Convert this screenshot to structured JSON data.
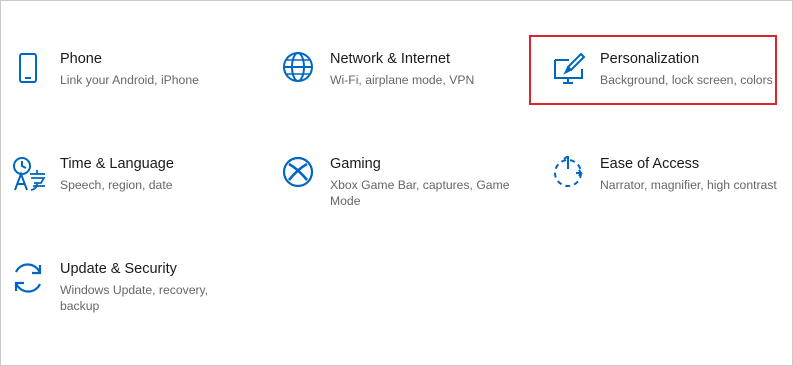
{
  "settings": {
    "items": [
      {
        "title": "Phone",
        "description": "Link your Android, iPhone",
        "icon": "phone-icon"
      },
      {
        "title": "Network & Internet",
        "description": "Wi-Fi, airplane mode, VPN",
        "icon": "globe-icon"
      },
      {
        "title": "Personalization",
        "description": "Background, lock screen, colors",
        "icon": "personalization-icon"
      },
      {
        "title": "Time & Language",
        "description": "Speech, region, date",
        "icon": "time-language-icon"
      },
      {
        "title": "Gaming",
        "description": "Xbox Game Bar, captures, Game Mode",
        "icon": "xbox-icon"
      },
      {
        "title": "Ease of Access",
        "description": "Narrator, magnifier, high contrast",
        "icon": "ease-of-access-icon"
      },
      {
        "title": "Update & Security",
        "description": "Windows Update, recovery, backup",
        "icon": "update-sync-icon"
      }
    ]
  },
  "colors": {
    "accent": "#0067c0",
    "highlight_border": "#d9262e",
    "title_text": "#1a1a1a",
    "description_text": "#666666"
  }
}
